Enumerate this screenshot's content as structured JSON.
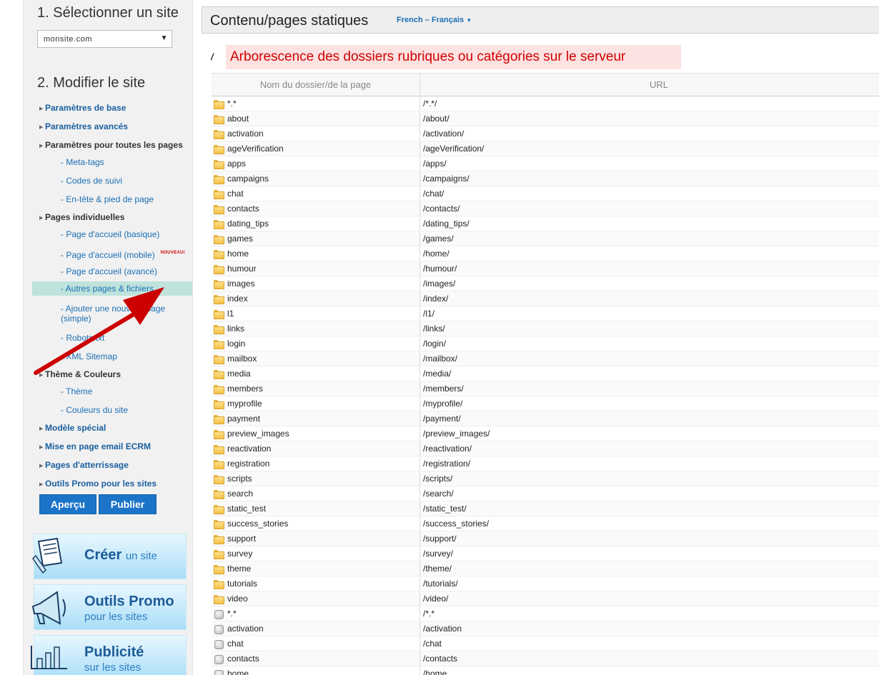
{
  "sidebar": {
    "step1_title": "1. Sélectionner un site",
    "site_select_value": "monsite.com",
    "step2_title": "2. Modifier le site",
    "nav": {
      "base_params": "Paramètres de base",
      "advanced_params": "Paramètres avancés",
      "all_pages_params": "Paramètres pour toutes les pages",
      "meta_tags": "- Meta-tags",
      "tracking_codes": "- Codes de suivi",
      "header_footer": "- En-tête & pied de page",
      "individual_pages": "Pages individuelles",
      "home_basic": "- Page d'accueil (basique)",
      "home_mobile": "- Page d'accueil (mobile)",
      "new_badge": "NOUVEAU!",
      "home_advanced": "- Page d'accueil (avancé)",
      "other_pages": "- Autres pages & fichiers",
      "add_page": "- Ajouter une nouvelle page (simple)",
      "robots": "- Robots.txt",
      "xml_sitemap": "- XML Sitemap",
      "theme_colors": "Thème & Couleurs",
      "theme": "- Thème",
      "site_colors": "- Couleurs du site",
      "special_model": "Modèle spécial",
      "email_layout": "Mise en page email ECRM",
      "landing_pages": "Pages d'atterrissage",
      "promo_tools": "Outils Promo pour les sites"
    },
    "preview_button": "Aperçu",
    "publish_button": "Publier",
    "promos": [
      {
        "title": "Créer",
        "subtitle": "un site"
      },
      {
        "title": "Outils Promo",
        "subtitle": "pour les sites"
      },
      {
        "title": "Publicité",
        "subtitle": "sur les sites"
      }
    ]
  },
  "header": {
    "title": "Contenu/pages statiques",
    "language": "French – Français"
  },
  "path": "/",
  "banner": "Arborescence des dossiers rubriques ou catégories sur le serveur",
  "table": {
    "col_name": "Nom du dossier/de la page",
    "col_url": "URL",
    "rows": [
      {
        "type": "folder",
        "name": "*.*",
        "url": "/*.*/"
      },
      {
        "type": "folder",
        "name": "about",
        "url": "/about/"
      },
      {
        "type": "folder",
        "name": "activation",
        "url": "/activation/"
      },
      {
        "type": "folder",
        "name": "ageVerification",
        "url": "/ageVerification/"
      },
      {
        "type": "folder",
        "name": "apps",
        "url": "/apps/"
      },
      {
        "type": "folder",
        "name": "campaigns",
        "url": "/campaigns/"
      },
      {
        "type": "folder",
        "name": "chat",
        "url": "/chat/"
      },
      {
        "type": "folder",
        "name": "contacts",
        "url": "/contacts/"
      },
      {
        "type": "folder",
        "name": "dating_tips",
        "url": "/dating_tips/"
      },
      {
        "type": "folder",
        "name": "games",
        "url": "/games/"
      },
      {
        "type": "folder",
        "name": "home",
        "url": "/home/"
      },
      {
        "type": "folder",
        "name": "humour",
        "url": "/humour/"
      },
      {
        "type": "folder",
        "name": "images",
        "url": "/images/"
      },
      {
        "type": "folder",
        "name": "index",
        "url": "/index/"
      },
      {
        "type": "folder",
        "name": "l1",
        "url": "/l1/"
      },
      {
        "type": "folder",
        "name": "links",
        "url": "/links/"
      },
      {
        "type": "folder",
        "name": "login",
        "url": "/login/"
      },
      {
        "type": "folder",
        "name": "mailbox",
        "url": "/mailbox/"
      },
      {
        "type": "folder",
        "name": "media",
        "url": "/media/"
      },
      {
        "type": "folder",
        "name": "members",
        "url": "/members/"
      },
      {
        "type": "folder",
        "name": "myprofile",
        "url": "/myprofile/"
      },
      {
        "type": "folder",
        "name": "payment",
        "url": "/payment/"
      },
      {
        "type": "folder",
        "name": "preview_images",
        "url": "/preview_images/"
      },
      {
        "type": "folder",
        "name": "reactivation",
        "url": "/reactivation/"
      },
      {
        "type": "folder",
        "name": "registration",
        "url": "/registration/"
      },
      {
        "type": "folder",
        "name": "scripts",
        "url": "/scripts/"
      },
      {
        "type": "folder",
        "name": "search",
        "url": "/search/"
      },
      {
        "type": "folder",
        "name": "static_test",
        "url": "/static_test/"
      },
      {
        "type": "folder",
        "name": "success_stories",
        "url": "/success_stories/"
      },
      {
        "type": "folder",
        "name": "support",
        "url": "/support/"
      },
      {
        "type": "folder",
        "name": "survey",
        "url": "/survey/"
      },
      {
        "type": "folder",
        "name": "theme",
        "url": "/theme/"
      },
      {
        "type": "folder",
        "name": "tutorials",
        "url": "/tutorials/"
      },
      {
        "type": "folder",
        "name": "video",
        "url": "/video/"
      },
      {
        "type": "file",
        "name": "*.*",
        "url": "/*.*"
      },
      {
        "type": "file",
        "name": "activation",
        "url": "/activation"
      },
      {
        "type": "file",
        "name": "chat",
        "url": "/chat"
      },
      {
        "type": "file",
        "name": "contacts",
        "url": "/contacts"
      },
      {
        "type": "file",
        "name": "home",
        "url": "/home"
      }
    ]
  },
  "colors": {
    "link_blue": "#1a6fb5",
    "button_blue": "#1b74c8",
    "banner_red": "#d00000",
    "banner_bg": "#fde2e2",
    "active_item_bg": "#bfe3dc",
    "annotation_arrow": "#cc0000"
  }
}
